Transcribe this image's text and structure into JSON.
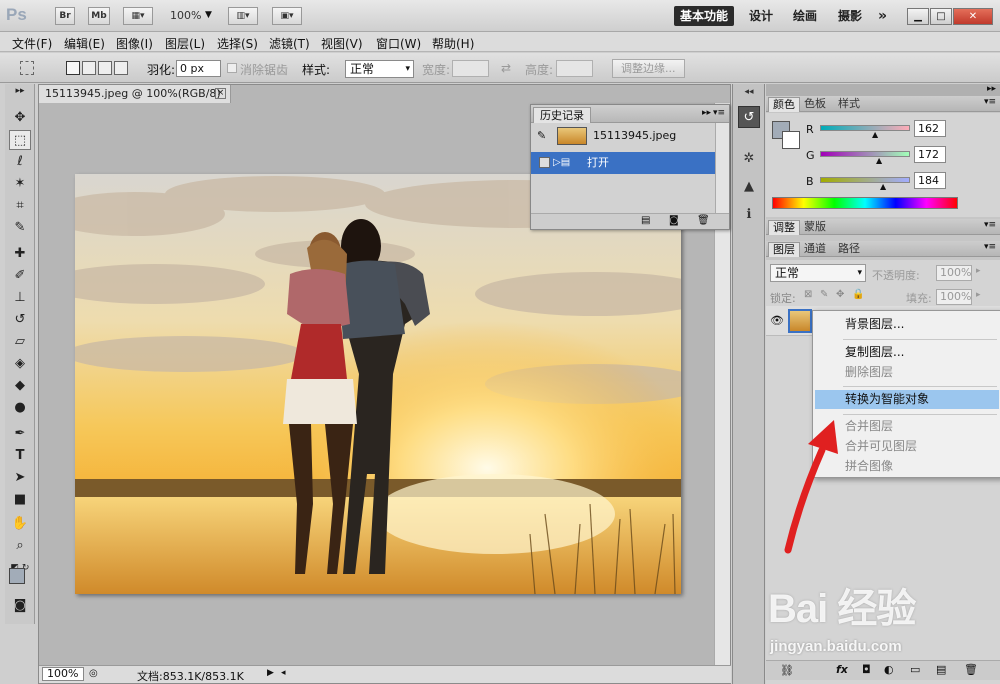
{
  "app": {
    "logo": "Ps",
    "bridge_label": "Br",
    "minibridge_label": "Mb",
    "zoom": "100%",
    "workspaces": [
      "基本功能",
      "设计",
      "绘画",
      "摄影"
    ],
    "more_label": "»"
  },
  "menu": [
    "文件(F)",
    "编辑(E)",
    "图像(I)",
    "图层(L)",
    "选择(S)",
    "滤镜(T)",
    "视图(V)",
    "窗口(W)",
    "帮助(H)"
  ],
  "options": {
    "feather_label": "羽化:",
    "feather_value": "0 px",
    "antialias_label": "消除锯齿",
    "style_label": "样式:",
    "style_value": "正常",
    "width_label": "宽度:",
    "height_label": "高度:",
    "refine_edge": "调整边缘..."
  },
  "document": {
    "tab_title": "15113945.jpeg @ 100%(RGB/8)",
    "tab_close": "×",
    "zoom": "100%",
    "doc_info": "文档:853.1K/853.1K"
  },
  "history": {
    "title": "历史记录",
    "snapshot": "15113945.jpeg",
    "items": [
      {
        "label": "打开"
      }
    ]
  },
  "color_panel": {
    "tabs": [
      "颜色",
      "色板",
      "样式"
    ],
    "r_label": "R",
    "g_label": "G",
    "b_label": "B",
    "r": "162",
    "g": "172",
    "b": "184",
    "fg_color": "#a2acb8"
  },
  "adjust_panel": {
    "tabs": [
      "调整",
      "蒙版"
    ]
  },
  "layers_panel": {
    "tabs": [
      "图层",
      "通道",
      "路径"
    ],
    "blend_mode": "正常",
    "opacity_label": "不透明度:",
    "opacity_value": "100%",
    "lock_label": "锁定:",
    "fill_label": "填充:",
    "fill_value": "100%"
  },
  "context_menu": {
    "items": [
      {
        "label": "背景图层...",
        "state": "enabled"
      },
      {
        "label": "复制图层...",
        "state": "enabled"
      },
      {
        "label": "删除图层",
        "state": "disabled"
      },
      {
        "label": "转换为智能对象",
        "state": "highlighted"
      },
      {
        "label": "合并图层",
        "state": "disabled"
      },
      {
        "label": "合并可见图层",
        "state": "disabled"
      },
      {
        "label": "拼合图像",
        "state": "disabled"
      }
    ]
  },
  "watermark": {
    "brand": "Bai 经验",
    "url": "jingyan.baidu.com"
  },
  "colors": {
    "selection_blue": "#3a71c4",
    "menu_highlight": "#9bc6ee",
    "arrow_red": "#e02020"
  }
}
